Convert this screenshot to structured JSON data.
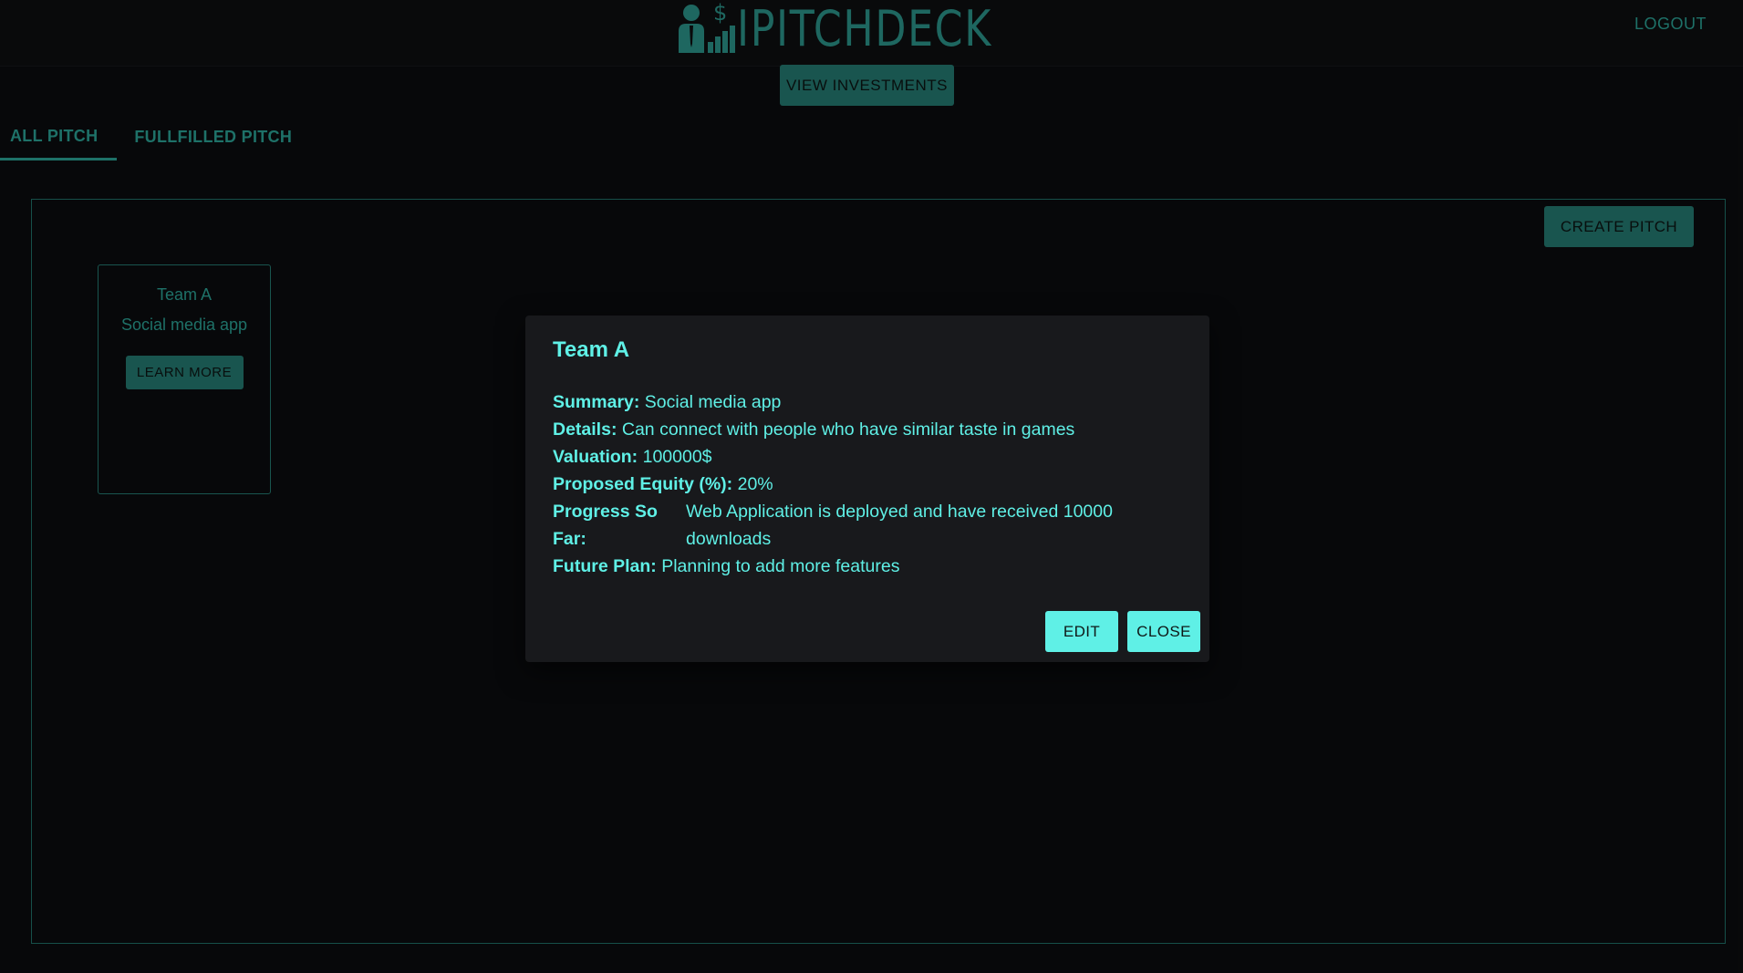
{
  "header": {
    "logo_text": "IPITCHDECK",
    "logout_label": "LOGOUT",
    "view_investments_label": "VIEW INVESTMENTS"
  },
  "tabs": [
    {
      "label": "ALL PITCH",
      "active": true
    },
    {
      "label": "FULLFILLED PITCH",
      "active": false
    }
  ],
  "panel": {
    "create_pitch_label": "CREATE PITCH",
    "cards": [
      {
        "title": "Team A",
        "summary": "Social media app",
        "button_label": "LEARN MORE"
      }
    ]
  },
  "dialog": {
    "title": "Team A",
    "summary_label": "Summary:",
    "summary_value": "Social media app",
    "details_label": "Details:",
    "details_value": "Can connect with people who have similar taste in games",
    "valuation_label": "Valuation:",
    "valuation_value": "100000$",
    "equity_label": "Proposed Equity (%):",
    "equity_value": "20%",
    "progress_label": "Progress So Far:",
    "progress_value": "Web Application is deployed and have received 10000 downloads",
    "future_label": "Future Plan:",
    "future_value": "Planning to add more features",
    "edit_label": "EDIT",
    "close_label": "CLOSE"
  },
  "colors": {
    "accent": "#23766e",
    "accent_text": "#2a9d91",
    "dialog_text": "#5ff0e6",
    "background": "#0b0c0e"
  },
  "icons": {
    "logo": "investor-chart-icon"
  }
}
